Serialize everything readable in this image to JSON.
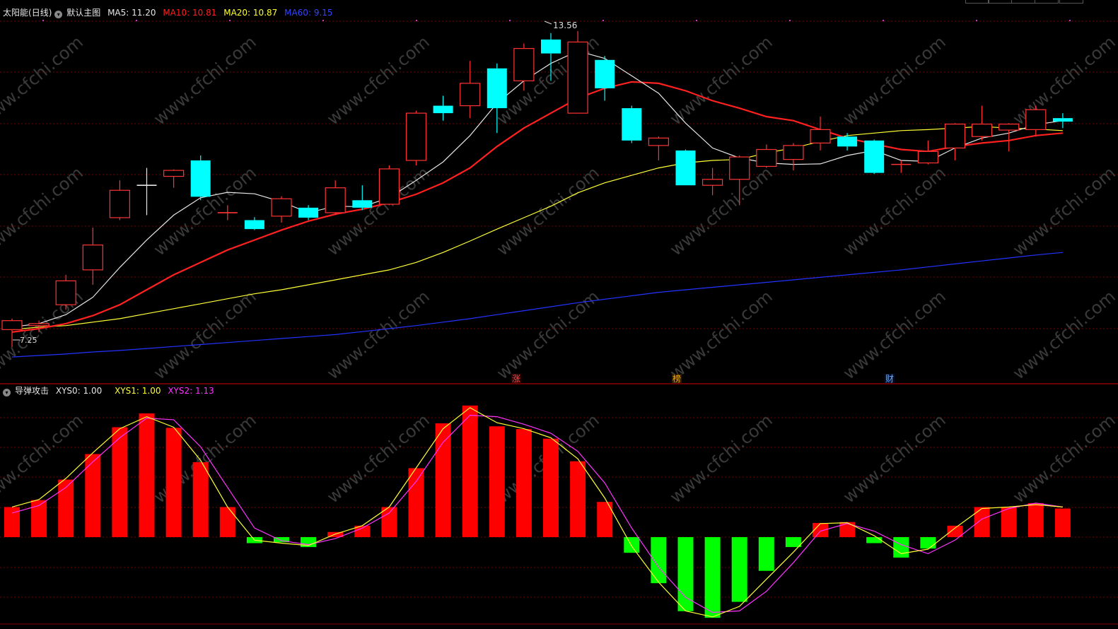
{
  "main": {
    "stock_name": "太阳能",
    "period": "(日线)",
    "chart_name": "默认主图",
    "ma5": {
      "label": "MA5:",
      "value": "11.20",
      "color": "#e6e6e6"
    },
    "ma10": {
      "label": "MA10:",
      "value": "10.81",
      "color": "#ff2020"
    },
    "ma20": {
      "label": "MA20:",
      "value": "10.87",
      "color": "#ffff33"
    },
    "ma60": {
      "label": "MA60:",
      "value": "9.15",
      "color": "#2233ff"
    },
    "high_label": "13.56",
    "low_label": "7.25",
    "markers": [
      "涨",
      "榜",
      "财"
    ]
  },
  "indicator": {
    "name": "导弹攻击",
    "xys0": {
      "label": "XYS0:",
      "value": "1.00"
    },
    "xys1": {
      "label": "XYS1:",
      "value": "1.00",
      "color": "#ffff33"
    },
    "xys2": {
      "label": "XYS2:",
      "value": "1.13",
      "color": "#ff33ff"
    }
  },
  "watermark": "www.cfchi.com",
  "colors": {
    "up": "#ff3333",
    "down": "#00ffff",
    "hist_up": "#ff0000",
    "hist_down": "#00ff00",
    "grid": "#7a0000"
  },
  "chart_data": {
    "type": "candlestick",
    "price_range": [
      7.0,
      14.0
    ],
    "candles": [
      {
        "o": 7.6,
        "c": 7.78,
        "h": 7.82,
        "l": 7.25
      },
      {
        "o": 7.68,
        "c": 7.72,
        "h": 7.78,
        "l": 7.55
      },
      {
        "o": 8.1,
        "c": 8.58,
        "h": 8.7,
        "l": 8.0
      },
      {
        "o": 8.8,
        "c": 9.3,
        "h": 9.65,
        "l": 8.5
      },
      {
        "o": 9.85,
        "c": 10.4,
        "h": 10.6,
        "l": 9.8
      },
      {
        "o": 10.5,
        "c": 10.5,
        "h": 10.85,
        "l": 9.9
      },
      {
        "o": 10.68,
        "c": 10.8,
        "h": 10.82,
        "l": 10.45
      },
      {
        "o": 11.0,
        "c": 10.27,
        "h": 11.1,
        "l": 10.2
      },
      {
        "o": 9.95,
        "c": 9.95,
        "h": 10.1,
        "l": 9.8
      },
      {
        "o": 9.8,
        "c": 9.62,
        "h": 9.86,
        "l": 9.6
      },
      {
        "o": 9.88,
        "c": 10.23,
        "h": 10.28,
        "l": 9.75
      },
      {
        "o": 10.05,
        "c": 9.85,
        "h": 10.1,
        "l": 9.8
      },
      {
        "o": 9.95,
        "c": 10.45,
        "h": 10.6,
        "l": 9.9
      },
      {
        "o": 10.2,
        "c": 10.05,
        "h": 10.5,
        "l": 10.0
      },
      {
        "o": 10.12,
        "c": 10.83,
        "h": 10.9,
        "l": 10.1
      },
      {
        "o": 11.0,
        "c": 11.95,
        "h": 12.0,
        "l": 10.9
      },
      {
        "o": 12.1,
        "c": 11.95,
        "h": 12.3,
        "l": 11.8
      },
      {
        "o": 12.1,
        "c": 12.55,
        "h": 13.0,
        "l": 11.85
      },
      {
        "o": 12.85,
        "c": 12.05,
        "h": 12.95,
        "l": 11.55
      },
      {
        "o": 12.6,
        "c": 13.25,
        "h": 13.35,
        "l": 12.4
      },
      {
        "o": 13.43,
        "c": 13.15,
        "h": 13.56,
        "l": 12.6
      },
      {
        "o": 11.95,
        "c": 13.38,
        "h": 13.6,
        "l": 11.95
      },
      {
        "o": 13.02,
        "c": 12.45,
        "h": 13.1,
        "l": 12.2
      },
      {
        "o": 12.05,
        "c": 11.4,
        "h": 12.1,
        "l": 11.35
      },
      {
        "o": 11.3,
        "c": 11.45,
        "h": 11.48,
        "l": 11.0
      },
      {
        "o": 11.2,
        "c": 10.5,
        "h": 11.22,
        "l": 10.5
      },
      {
        "o": 10.5,
        "c": 10.62,
        "h": 10.85,
        "l": 10.3
      },
      {
        "o": 10.62,
        "c": 11.07,
        "h": 11.1,
        "l": 10.1
      },
      {
        "o": 10.88,
        "c": 11.22,
        "h": 11.32,
        "l": 10.85
      },
      {
        "o": 11.02,
        "c": 11.3,
        "h": 11.35,
        "l": 10.8
      },
      {
        "o": 11.35,
        "c": 11.62,
        "h": 11.88,
        "l": 11.2
      },
      {
        "o": 11.48,
        "c": 11.28,
        "h": 11.55,
        "l": 11.2
      },
      {
        "o": 11.4,
        "c": 10.75,
        "h": 11.42,
        "l": 10.73
      },
      {
        "o": 10.92,
        "c": 10.92,
        "h": 11.0,
        "l": 10.75
      },
      {
        "o": 10.95,
        "c": 11.18,
        "h": 11.4,
        "l": 10.92
      },
      {
        "o": 11.25,
        "c": 11.73,
        "h": 11.75,
        "l": 11.0
      },
      {
        "o": 11.48,
        "c": 11.73,
        "h": 12.1,
        "l": 11.4
      },
      {
        "o": 11.61,
        "c": 11.73,
        "h": 11.75,
        "l": 11.18
      },
      {
        "o": 11.62,
        "c": 12.02,
        "h": 12.1,
        "l": 11.48
      },
      {
        "o": 11.85,
        "c": 11.78,
        "h": 11.95,
        "l": 11.65
      }
    ],
    "ma5": [
      7.65,
      7.72,
      7.9,
      8.25,
      8.85,
      9.4,
      9.9,
      10.25,
      10.36,
      10.33,
      10.17,
      9.95,
      10.08,
      10.07,
      10.25,
      10.6,
      10.97,
      11.5,
      12.15,
      12.6,
      12.95,
      13.2,
      13.05,
      12.7,
      12.35,
      11.75,
      11.25,
      11.05,
      10.95,
      10.92,
      10.93,
      11.1,
      11.2,
      11.0,
      10.98,
      11.25,
      11.45,
      11.55,
      11.72,
      11.8
    ],
    "ma10": [
      7.55,
      7.62,
      7.72,
      7.88,
      8.1,
      8.4,
      8.7,
      8.95,
      9.2,
      9.4,
      9.6,
      9.78,
      9.92,
      10.02,
      10.15,
      10.32,
      10.55,
      10.85,
      11.28,
      11.65,
      11.95,
      12.25,
      12.45,
      12.58,
      12.55,
      12.4,
      12.2,
      12.05,
      11.88,
      11.8,
      11.62,
      11.45,
      11.33,
      11.22,
      11.18,
      11.28,
      11.35,
      11.4,
      11.5,
      11.55
    ],
    "ma20": [
      7.6,
      7.65,
      7.68,
      7.75,
      7.82,
      7.92,
      8.02,
      8.12,
      8.22,
      8.32,
      8.4,
      8.5,
      8.6,
      8.7,
      8.8,
      8.95,
      9.15,
      9.38,
      9.62,
      9.85,
      10.08,
      10.35,
      10.55,
      10.7,
      10.85,
      10.95,
      11.0,
      11.02,
      11.15,
      11.25,
      11.38,
      11.5,
      11.55,
      11.6,
      11.62,
      11.65,
      11.68,
      11.65,
      11.63,
      11.6
    ],
    "ma60": [
      7.05,
      7.08,
      7.11,
      7.15,
      7.18,
      7.22,
      7.26,
      7.3,
      7.34,
      7.38,
      7.42,
      7.46,
      7.5,
      7.56,
      7.62,
      7.68,
      7.75,
      7.82,
      7.9,
      7.98,
      8.06,
      8.14,
      8.21,
      8.28,
      8.35,
      8.4,
      8.45,
      8.5,
      8.55,
      8.6,
      8.65,
      8.7,
      8.75,
      8.8,
      8.86,
      8.92,
      8.98,
      9.04,
      9.1,
      9.15
    ],
    "hist": [
      1.0,
      1.23,
      1.91,
      2.76,
      3.65,
      4.11,
      3.63,
      2.49,
      1.0,
      -0.2,
      -0.17,
      -0.33,
      0.17,
      0.38,
      1.0,
      2.29,
      3.78,
      4.37,
      3.68,
      3.59,
      3.27,
      2.52,
      1.17,
      -0.52,
      -1.53,
      -2.46,
      -2.68,
      -2.15,
      -1.12,
      -0.33,
      0.47,
      0.5,
      -0.2,
      -0.68,
      -0.38,
      0.38,
      1.0,
      1.0,
      1.13,
      0.95
    ],
    "xys1": [
      1.0,
      1.25,
      1.95,
      2.8,
      3.6,
      4.0,
      3.65,
      2.55,
      1.0,
      -0.1,
      -0.2,
      -0.28,
      0.1,
      0.38,
      1.0,
      2.3,
      3.6,
      4.3,
      3.8,
      3.6,
      3.3,
      2.6,
      1.3,
      -0.3,
      -1.5,
      -2.45,
      -2.65,
      -2.3,
      -1.4,
      -0.5,
      0.45,
      0.48,
      0.05,
      -0.55,
      -0.4,
      0.3,
      0.95,
      1.0,
      1.08,
      1.0
    ],
    "xys2": [
      0.8,
      1.05,
      1.65,
      2.5,
      3.3,
      3.95,
      3.9,
      3.0,
      1.65,
      0.3,
      -0.12,
      -0.25,
      -0.05,
      0.3,
      0.8,
      1.85,
      3.15,
      4.05,
      4.0,
      3.75,
      3.45,
      2.85,
      1.8,
      0.3,
      -1.0,
      -2.0,
      -2.5,
      -2.45,
      -1.8,
      -0.85,
      0.2,
      0.45,
      0.2,
      -0.25,
      -0.55,
      -0.1,
      0.6,
      0.95,
      1.13,
      1.0
    ],
    "hist_range": [
      -2.8,
      4.5
    ]
  }
}
